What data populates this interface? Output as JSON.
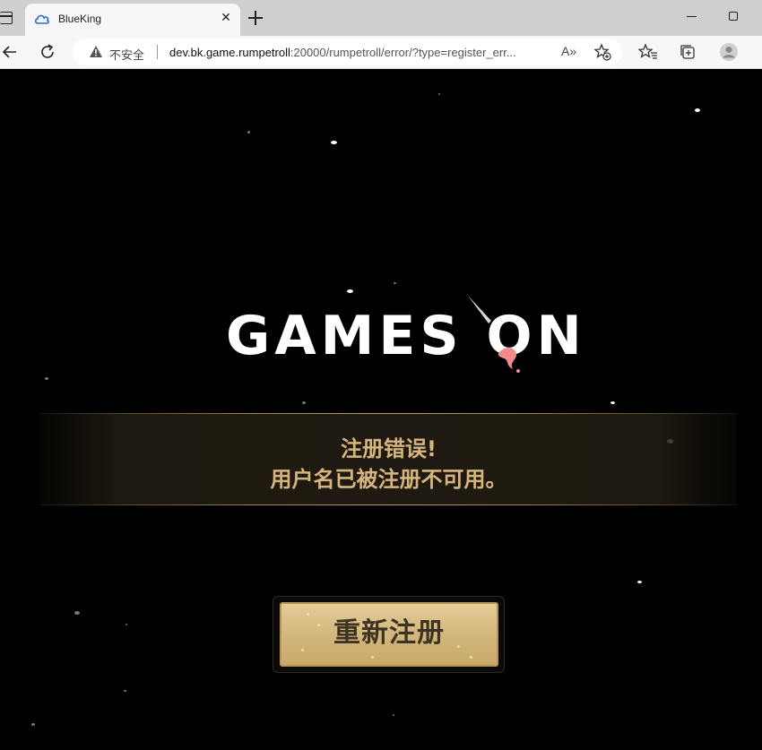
{
  "browser": {
    "tab_title": "BlueKing",
    "tab_close": "✕",
    "security_label": "不安全",
    "url_host": "dev.bk.game.rumpetroll",
    "url_rest": ":20000/rumpetroll/error/?type=register_err...",
    "read_aloud": "A»",
    "favicon": "blueking-cloud-icon"
  },
  "game": {
    "logo": "GAMES ON",
    "error_title": "注册错误!",
    "error_message": "用户名已被注册不可用。",
    "retry_button": "重新注册"
  },
  "colors": {
    "banner_text": "#d6b57c",
    "button_face": "#d8bc82",
    "button_text": "#3d3322"
  }
}
